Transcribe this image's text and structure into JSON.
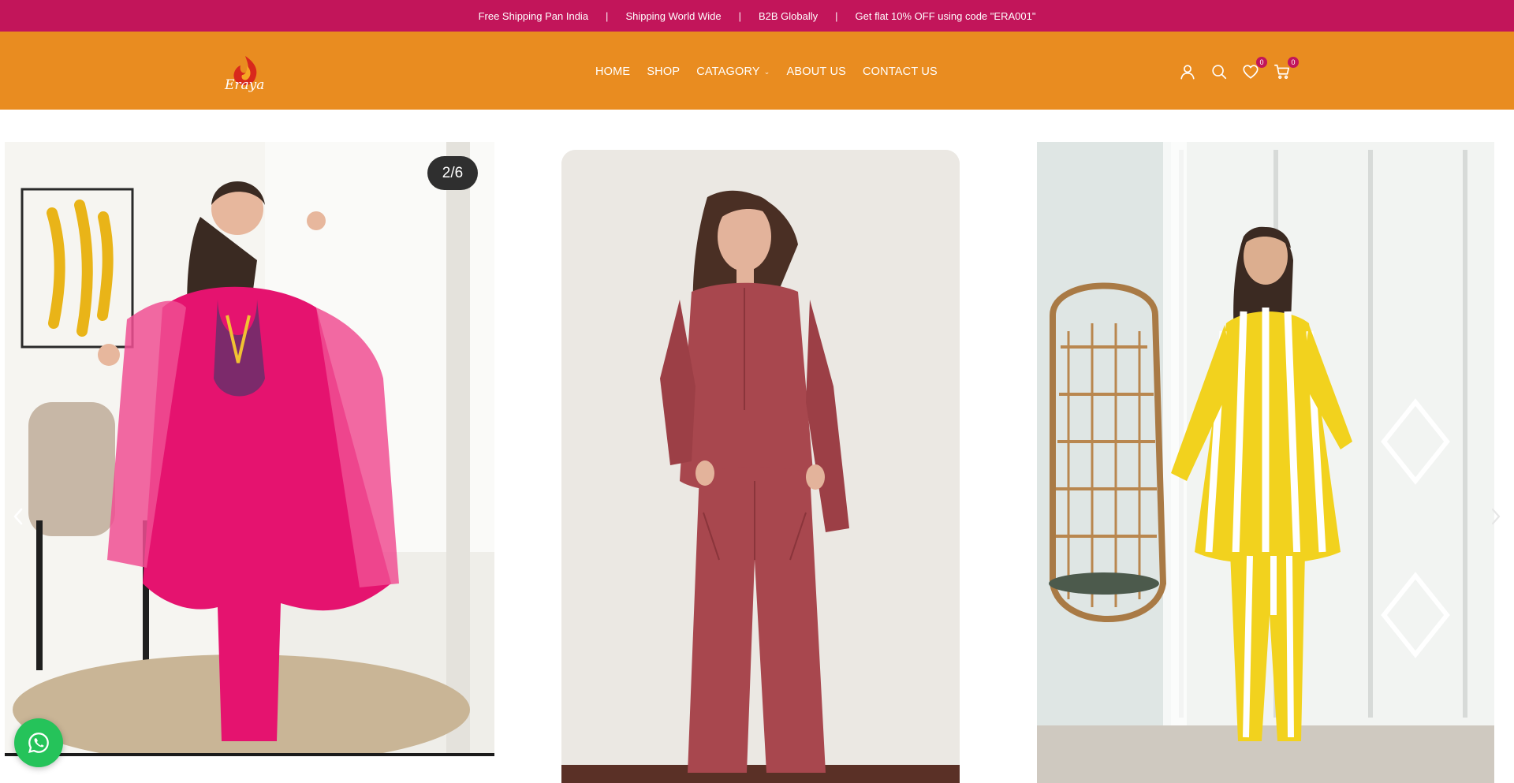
{
  "announcement": {
    "items": [
      "Free Shipping Pan India",
      "Shipping World Wide",
      "B2B Globally",
      "Get flat 10% OFF using code \"ERA001\""
    ],
    "separator": "|"
  },
  "brand": {
    "logo_text": "Eraya",
    "logo_icon": "flame-logo-icon"
  },
  "nav": [
    {
      "label": "HOME"
    },
    {
      "label": "SHOP"
    },
    {
      "label": "CATAGORY",
      "has_dropdown": true,
      "caret": "⌄"
    },
    {
      "label": "ABOUT US"
    },
    {
      "label": "CONTACT US"
    }
  ],
  "header_icons": {
    "account": "user-icon",
    "search": "search-icon",
    "wishlist": {
      "icon": "heart-icon",
      "count": "0"
    },
    "cart": {
      "icon": "cart-icon",
      "count": "0"
    }
  },
  "slider": {
    "counter": "2/6",
    "slides": [
      {
        "name": "pink-kaftan-set",
        "garment_color": "#e5136f"
      },
      {
        "name": "maroon-co-ord-set",
        "garment_color": "#a8474e"
      },
      {
        "name": "yellow-stripe-co-ord-set",
        "garment_color": "#f2d21e"
      }
    ],
    "prev_icon": "chevron-left-icon",
    "next_icon": "chevron-right-icon"
  },
  "whatsapp": {
    "icon": "whatsapp-icon"
  },
  "colors": {
    "announcement_bg": "#c2155a",
    "header_bg": "#e98c20",
    "badge_bg": "#c2155a",
    "whatsapp_bg": "#25c35a"
  }
}
